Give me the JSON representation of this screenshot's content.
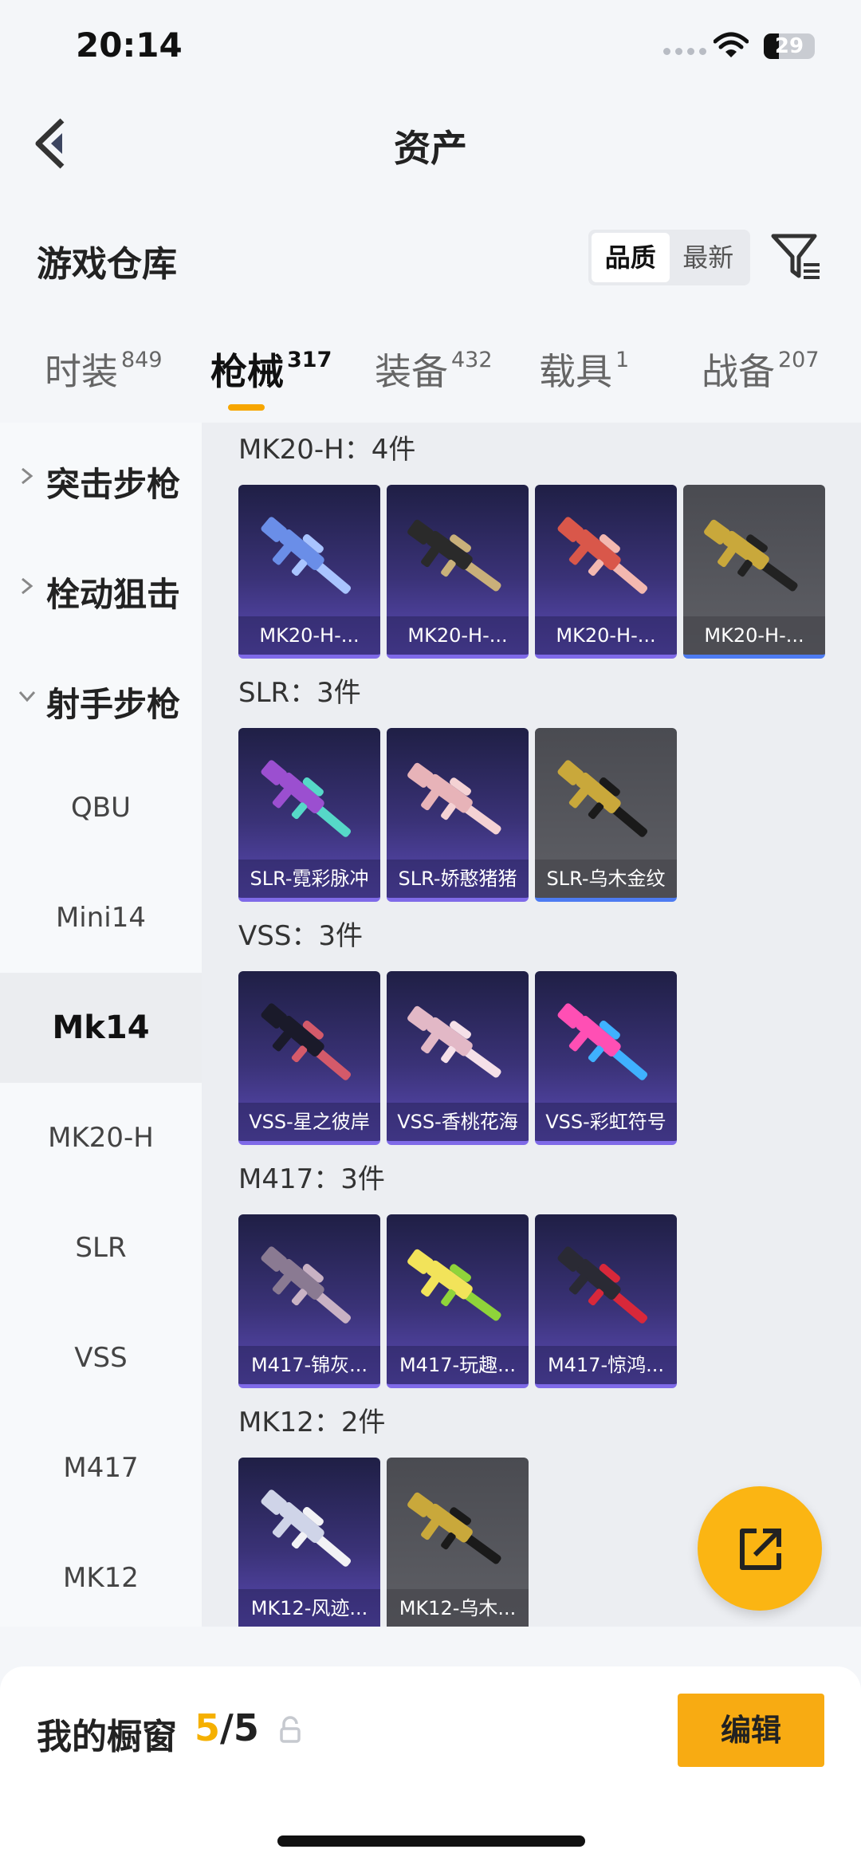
{
  "status_bar": {
    "time": "20:14",
    "battery": "29",
    "battery_level": 0.29
  },
  "header": {
    "title": "资产"
  },
  "section": {
    "title": "游戏仓库"
  },
  "sort": {
    "options": [
      "品质",
      "最新"
    ],
    "active": 0
  },
  "tabs": [
    {
      "label": "时装",
      "count": "849"
    },
    {
      "label": "枪械",
      "count": "317"
    },
    {
      "label": "装备",
      "count": "432"
    },
    {
      "label": "载具",
      "count": "1"
    },
    {
      "label": "战备",
      "count": "207"
    }
  ],
  "active_tab": 1,
  "sidenav": {
    "categories": [
      {
        "label": "突击步枪",
        "expanded": false
      },
      {
        "label": "栓动狙击",
        "expanded": false
      },
      {
        "label": "射手步枪",
        "expanded": true
      }
    ],
    "items": [
      "QBU",
      "Mini14",
      "Mk14",
      "MK20-H",
      "SLR",
      "VSS",
      "M417",
      "MK12"
    ],
    "active_item": "Mk14"
  },
  "groups": [
    {
      "title": "MK20-H：4件",
      "cards": [
        {
          "name": "MK20-H-...",
          "rarity": "purple"
        },
        {
          "name": "MK20-H-...",
          "rarity": "purple"
        },
        {
          "name": "MK20-H-...",
          "rarity": "purple"
        },
        {
          "name": "MK20-H-...",
          "rarity": "grey"
        }
      ]
    },
    {
      "title": "SLR：3件",
      "cards": [
        {
          "name": "SLR-霓彩脉冲",
          "rarity": "purple"
        },
        {
          "name": "SLR-娇憨猪猪",
          "rarity": "purple"
        },
        {
          "name": "SLR-乌木金纹",
          "rarity": "grey"
        }
      ]
    },
    {
      "title": "VSS：3件",
      "cards": [
        {
          "name": "VSS-星之彼岸",
          "rarity": "purple"
        },
        {
          "name": "VSS-香桃花海",
          "rarity": "purple"
        },
        {
          "name": "VSS-彩虹符号",
          "rarity": "purple"
        }
      ]
    },
    {
      "title": "M417：3件",
      "cards": [
        {
          "name": "M417-锦灰...",
          "rarity": "purple"
        },
        {
          "name": "M417-玩趣...",
          "rarity": "purple"
        },
        {
          "name": "M417-惊鸿...",
          "rarity": "purple"
        }
      ]
    },
    {
      "title": "MK12：2件",
      "cards": [
        {
          "name": "MK12-风迹...",
          "rarity": "purple"
        },
        {
          "name": "MK12-乌木...",
          "rarity": "grey"
        }
      ]
    }
  ],
  "showcase": {
    "label": "我的橱窗",
    "current": "5",
    "total": "/5",
    "edit_label": "编辑"
  },
  "colors": {
    "accent": "#f8ab12",
    "purple_card": "#3a3277",
    "grey_card": "#55565c",
    "blue_rarity": "#4d7bf2"
  }
}
